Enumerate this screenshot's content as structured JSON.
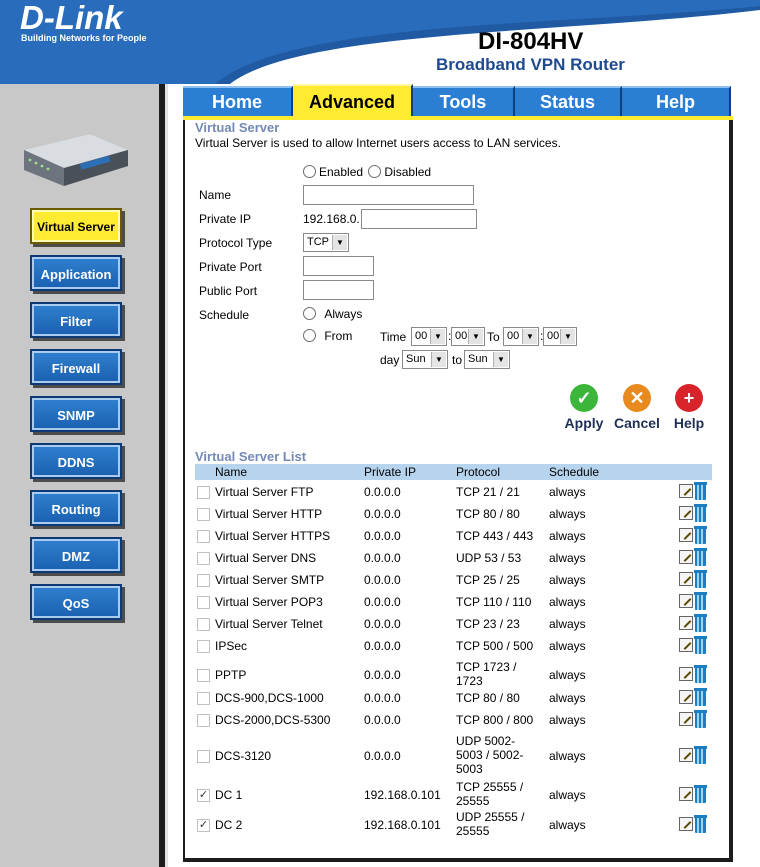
{
  "brand": {
    "logo": "D-Link",
    "tagline": "Building Networks for People",
    "model": "DI-804HV",
    "product": "Broadband VPN Router"
  },
  "tabs": [
    {
      "label": "Home",
      "active": false
    },
    {
      "label": "Advanced",
      "active": true
    },
    {
      "label": "Tools",
      "active": false
    },
    {
      "label": "Status",
      "active": false
    },
    {
      "label": "Help",
      "active": false
    }
  ],
  "sidebar": {
    "items": [
      {
        "label": "Virtual Server",
        "active": true
      },
      {
        "label": "Application",
        "active": false
      },
      {
        "label": "Filter",
        "active": false
      },
      {
        "label": "Firewall",
        "active": false
      },
      {
        "label": "SNMP",
        "active": false
      },
      {
        "label": "DDNS",
        "active": false
      },
      {
        "label": "Routing",
        "active": false
      },
      {
        "label": "DMZ",
        "active": false
      },
      {
        "label": "QoS",
        "active": false
      }
    ]
  },
  "form": {
    "title": "Virtual Server",
    "description": "Virtual Server is used to allow Internet users access to LAN services.",
    "enabled_label": "Enabled",
    "disabled_label": "Disabled",
    "name_label": "Name",
    "name_value": "",
    "private_ip_label": "Private IP",
    "private_ip_prefix": "192.168.0.",
    "private_ip_value": "",
    "protocol_label": "Protocol Type",
    "protocol_value": "TCP",
    "private_port_label": "Private Port",
    "private_port_value": "",
    "public_port_label": "Public Port",
    "public_port_value": "",
    "schedule_label": "Schedule",
    "always_label": "Always",
    "from_label": "From",
    "time_label": "Time",
    "to_label": "To",
    "day_label": "day",
    "day_to_label": "to",
    "time_from_h": "00",
    "time_from_m": "00",
    "time_to_h": "00",
    "time_to_m": "00",
    "day_from": "Sun",
    "day_to": "Sun",
    "colon": ":"
  },
  "actions": {
    "apply": "Apply",
    "cancel": "Cancel",
    "help": "Help"
  },
  "list": {
    "title": "Virtual Server List",
    "headers": {
      "name": "Name",
      "ip": "Private IP",
      "protocol": "Protocol",
      "schedule": "Schedule"
    },
    "rows": [
      {
        "checked": false,
        "name": "Virtual Server FTP",
        "ip": "0.0.0.0",
        "protocol": "TCP 21 / 21",
        "schedule": "always"
      },
      {
        "checked": false,
        "name": "Virtual Server HTTP",
        "ip": "0.0.0.0",
        "protocol": "TCP 80 / 80",
        "schedule": "always"
      },
      {
        "checked": false,
        "name": "Virtual Server HTTPS",
        "ip": "0.0.0.0",
        "protocol": "TCP 443 / 443",
        "schedule": "always"
      },
      {
        "checked": false,
        "name": "Virtual Server DNS",
        "ip": "0.0.0.0",
        "protocol": "UDP 53 / 53",
        "schedule": "always"
      },
      {
        "checked": false,
        "name": "Virtual Server SMTP",
        "ip": "0.0.0.0",
        "protocol": "TCP 25 / 25",
        "schedule": "always"
      },
      {
        "checked": false,
        "name": "Virtual Server POP3",
        "ip": "0.0.0.0",
        "protocol": "TCP 110 / 110",
        "schedule": "always"
      },
      {
        "checked": false,
        "name": "Virtual Server Telnet",
        "ip": "0.0.0.0",
        "protocol": "TCP 23 / 23",
        "schedule": "always"
      },
      {
        "checked": false,
        "name": "IPSec",
        "ip": "0.0.0.0",
        "protocol": "TCP 500 / 500",
        "schedule": "always"
      },
      {
        "checked": false,
        "name": "PPTP",
        "ip": "0.0.0.0",
        "protocol": "TCP 1723 / 1723",
        "schedule": "always"
      },
      {
        "checked": false,
        "name": "DCS-900,DCS-1000",
        "ip": "0.0.0.0",
        "protocol": "TCP 80 / 80",
        "schedule": "always"
      },
      {
        "checked": false,
        "name": "DCS-2000,DCS-5300",
        "ip": "0.0.0.0",
        "protocol": "TCP 800 / 800",
        "schedule": "always"
      },
      {
        "checked": false,
        "name": "DCS-3120",
        "ip": "0.0.0.0",
        "protocol": "UDP 5002-5003 / 5002-5003",
        "schedule": "always"
      },
      {
        "checked": true,
        "name": "DC 1",
        "ip": "192.168.0.101",
        "protocol": "TCP 25555 / 25555",
        "schedule": "always"
      },
      {
        "checked": true,
        "name": "DC 2",
        "ip": "192.168.0.101",
        "protocol": "UDP 25555 / 25555",
        "schedule": "always"
      }
    ]
  },
  "colors": {
    "accent_blue": "#2a7fd4",
    "active_yellow": "#ffeb32",
    "header_navy": "#1f4a8f",
    "section_title": "#7489b3",
    "list_header": "#b7d4ef"
  },
  "icons": {
    "apply": "check-circle-icon",
    "cancel": "x-circle-icon",
    "help": "plus-circle-icon",
    "edit": "edit-icon",
    "delete": "trash-icon"
  }
}
